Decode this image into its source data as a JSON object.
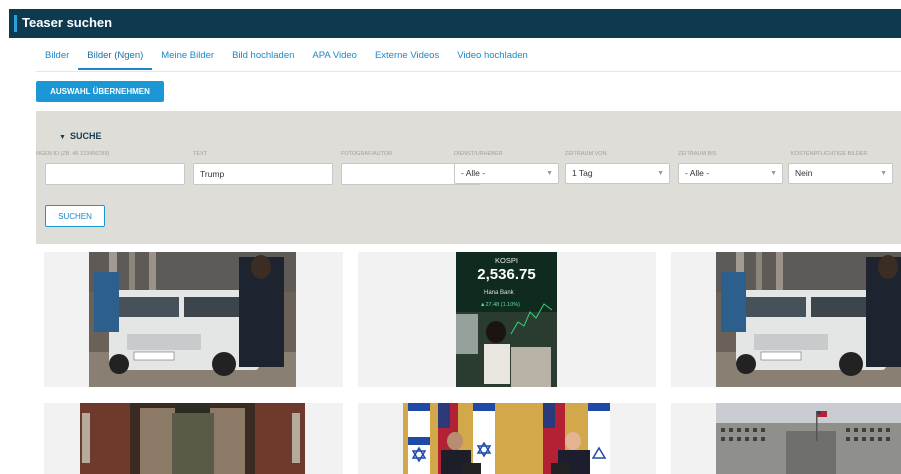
{
  "window": {
    "title": "Teaser suchen"
  },
  "tabs": [
    {
      "label": "Bilder"
    },
    {
      "label": "Bilder (Ngen)"
    },
    {
      "label": "Meine Bilder"
    },
    {
      "label": "Bild hochladen"
    },
    {
      "label": "APA Video"
    },
    {
      "label": "Externe Videos"
    },
    {
      "label": "Video hochladen"
    }
  ],
  "active_tab": "Bilder (Ngen)",
  "actions": {
    "apply_selection": "AUSWAHL ÜBERNEHMEN",
    "search": "SUCHEN"
  },
  "search": {
    "heading": "SUCHE",
    "fields": {
      "ngen_id": {
        "label": "NGEN ID (ZB. 46 123456789)",
        "value": ""
      },
      "text": {
        "label": "TEXT",
        "value": "Trump"
      },
      "photographer": {
        "label": "FOTOGRAF/AUTOR",
        "value": ""
      },
      "service": {
        "label": "DIENST/URHEBER",
        "value": "- Alle -"
      },
      "date_from": {
        "label": "ZEITRAUM VON",
        "value": "1 Tag"
      },
      "date_to": {
        "label": "ZEITRAUM BIS",
        "value": "- Alle -"
      },
      "paid": {
        "label": "KOSTENPFLICHTIGE BILDER",
        "value": "Nein"
      }
    }
  },
  "results": {
    "kospi_image": {
      "index": "KOSPI",
      "value": "2,536.75",
      "bank": "Hana Bank",
      "change": "▲27.48 (1.10%)"
    }
  },
  "colors": {
    "header_bg": "#0e3a4f",
    "accent": "#1a97d4",
    "panel_bg": "#deddd8"
  }
}
